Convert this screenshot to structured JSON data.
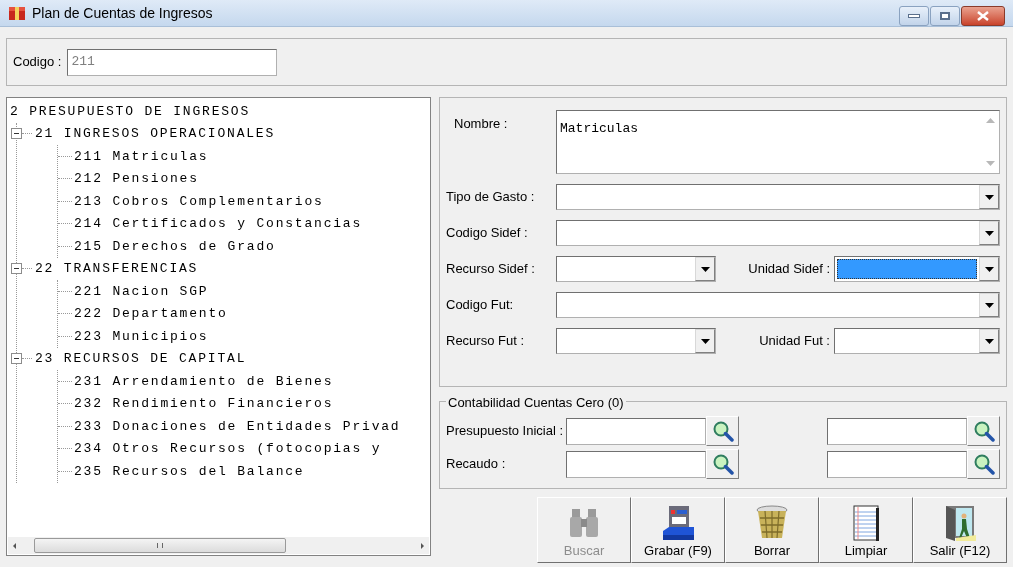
{
  "window": {
    "title": "Plan de Cuentas de Ingresos"
  },
  "codigo": {
    "label": "Codigo :",
    "value": "211"
  },
  "tree": {
    "label": "2 PRESUPUESTO DE INGRESOS",
    "children": [
      {
        "label": "21 INGRESOS OPERACIONALES",
        "expanded": true,
        "children": [
          {
            "label": "211 Matriculas"
          },
          {
            "label": "212 Pensiones"
          },
          {
            "label": "213 Cobros Complementarios"
          },
          {
            "label": "214 Certificados y Constancias"
          },
          {
            "label": "215 Derechos de Grado"
          }
        ]
      },
      {
        "label": "22 TRANSFERENCIAS",
        "expanded": true,
        "children": [
          {
            "label": "221 Nacion SGP"
          },
          {
            "label": "222 Departamento"
          },
          {
            "label": "223 Municipios"
          }
        ]
      },
      {
        "label": "23 RECURSOS DE CAPITAL",
        "expanded": true,
        "children": [
          {
            "label": "231 Arrendamiento de Bienes"
          },
          {
            "label": "232 Rendimiento Financieros"
          },
          {
            "label": "233 Donaciones de Entidades Privad"
          },
          {
            "label": "234 Otros Recursos  (fotocopias y"
          },
          {
            "label": "235 Recursos del Balance"
          }
        ]
      }
    ]
  },
  "nombre": {
    "label": "Nombre :",
    "value": "Matriculas"
  },
  "combo_rows": [
    {
      "fields": [
        {
          "label": "Tipo de Gasto :",
          "focused": false
        }
      ]
    },
    {
      "fields": [
        {
          "label": "Codigo Sidef :",
          "focused": false
        }
      ]
    },
    {
      "fields": [
        {
          "label": "Recurso Sidef :",
          "focused": false
        },
        {
          "label": "Unidad Sidef :",
          "focused": true
        }
      ]
    },
    {
      "fields": [
        {
          "label": "Codigo Fut:",
          "focused": false
        }
      ]
    },
    {
      "fields": [
        {
          "label": "Recurso Fut :",
          "focused": false
        },
        {
          "label": "Unidad Fut :",
          "focused": false
        }
      ]
    }
  ],
  "contabilidad": {
    "title": "Contabilidad Cuentas Cero (0)",
    "rows": [
      {
        "label": "Presupuesto Inicial :"
      },
      {
        "label": "Recaudo :"
      }
    ]
  },
  "buttons": [
    {
      "label": "Buscar",
      "kind": "binoculars",
      "disabled": true
    },
    {
      "label": "Grabar (F9)",
      "kind": "zip",
      "disabled": false
    },
    {
      "label": "Borrar",
      "kind": "basket",
      "disabled": false
    },
    {
      "label": "Limpiar",
      "kind": "notepad",
      "disabled": false
    },
    {
      "label": "Salir (F12)",
      "kind": "exit",
      "disabled": false
    }
  ]
}
